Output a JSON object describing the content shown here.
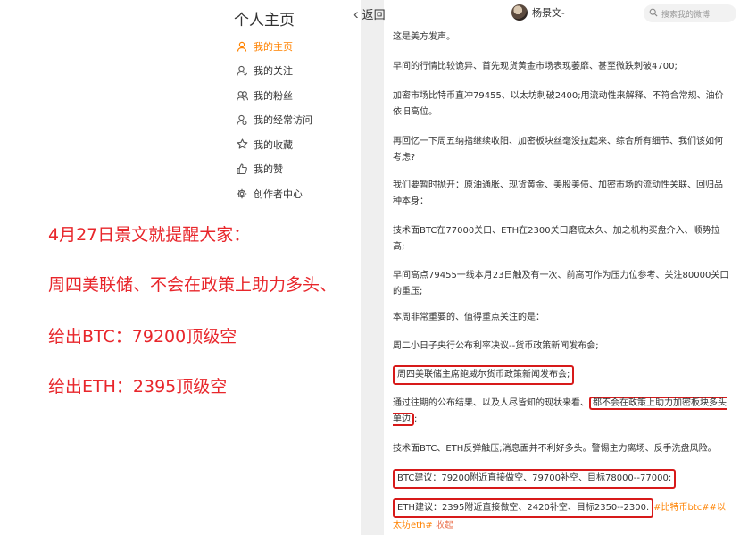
{
  "sidebar": {
    "title": "个人主页",
    "items": [
      {
        "label": "我的主页",
        "icon": "user-icon",
        "active": true
      },
      {
        "label": "我的关注",
        "icon": "user-follow-icon",
        "active": false
      },
      {
        "label": "我的粉丝",
        "icon": "fans-icon",
        "active": false
      },
      {
        "label": "我的经常访问",
        "icon": "user-visit-icon",
        "active": false
      },
      {
        "label": "我的收藏",
        "icon": "star-icon",
        "active": false
      },
      {
        "label": "我的赞",
        "icon": "thumbs-up-icon",
        "active": false
      },
      {
        "label": "创作者中心",
        "icon": "gear-icon",
        "active": false
      }
    ]
  },
  "promo": {
    "line1": "4月27日景文就提醒大家：",
    "line2": "周四美联储、不会在政策上助力多头、",
    "line3": "给出BTC：79200顶级空",
    "line4": "给出ETH：2395顶级空"
  },
  "header": {
    "back_label": "返回",
    "username": "杨景文-",
    "search_placeholder": "搜索我的微博"
  },
  "post": {
    "p1": "这是美方发声。",
    "p2": "早间的行情比较诡异、首先现货黄金市场表现萎靡、甚至微跌刺破4700;",
    "p3": "加密市场比特币直冲79455、以太坊刺破2400;用流动性来解释、不符合常规、油价依旧高位。",
    "p4": "再回忆一下周五纳指继续收阳、加密板块丝毫没拉起来、综合所有细节、我们该如何考虑?",
    "p5": "我们要暂时抛开：原油通胀、现货黄金、美股美债、加密市场的流动性关联、回归品种本身：",
    "p6": "技术面BTC在77000关口、ETH在2300关口磨底太久、加之机构买盘介入、顺势拉高;",
    "p7": "早间高点79455一线本月23日触及有一次、前高可作为压力位参考、关注80000关口的重压;",
    "p8": "本周非常重要的、值得重点关注的是：",
    "p9": "周二小日子央行公布利率决议--货币政策新闻发布会;",
    "p10": "周四美联储主席鲍威尔货币政策新闻发布会;",
    "p11_a": "通过往期的公布结果、以及人尽皆知的现状来看、",
    "p11_b": "都不会在政策上助力加密板块多头单边",
    "p11_c": ";",
    "p12": "技术面BTC、ETH反弹触压;消息面并不利好多头。警惕主力离场、反手洗盘风险。",
    "p13": "BTC建议：79200附近直接做空、79700补空、目标78000--77000;",
    "p14": "ETH建议：2395附近直接做空、2420补空、目标2350--2300.",
    "tags": "#比特币btc##以太坊eth#",
    "collect": "收起"
  },
  "colors": {
    "accent_orange": "#ff8200",
    "promo_red": "#e8262b",
    "box_red": "#d71a1a"
  }
}
